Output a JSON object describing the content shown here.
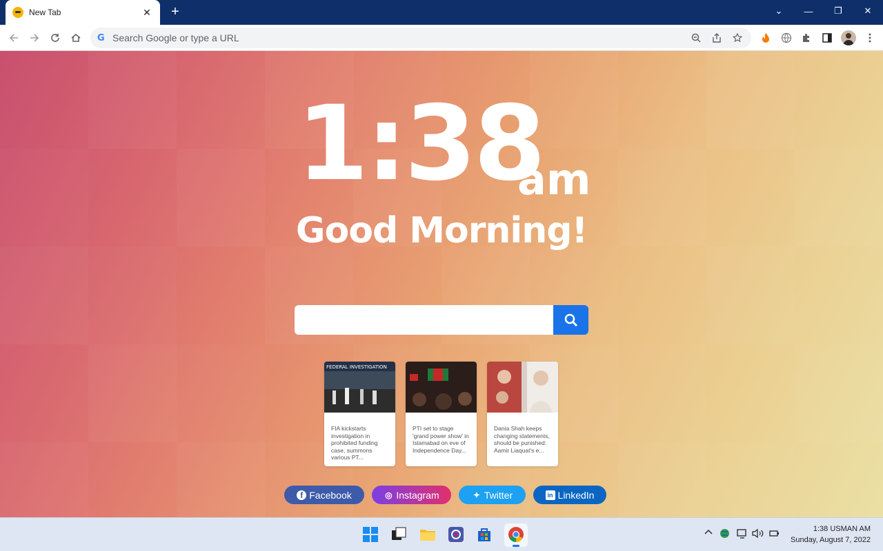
{
  "browser": {
    "tab_title": "New Tab",
    "tab_close": "✕",
    "new_tab": "+",
    "window_controls": [
      "⌄",
      "—",
      "❐",
      "✕"
    ],
    "omnibox_placeholder": "Search Google or type a URL",
    "omnibox_icon": "G"
  },
  "page": {
    "time": "1:38",
    "ampm": "am",
    "greeting": "Good Morning!",
    "search_value": "",
    "news": [
      {
        "text": "FIA kickstarts investigation in prohibited funding case, summons various PT..."
      },
      {
        "text": "PTI set to stage 'grand power show' in Islamabad on eve of Independence Day..."
      },
      {
        "text": "Dania Shah keeps changing statements, should be punished: Aamir Liaquat's e..."
      }
    ],
    "social": [
      {
        "label": "Facebook",
        "icon": "f",
        "color": "#3b5998"
      },
      {
        "label": "Instagram",
        "icon": "◎",
        "color": "#c13584"
      },
      {
        "label": "Twitter",
        "icon": "✦",
        "color": "#1da1f2"
      },
      {
        "label": "LinkedIn",
        "icon": "in",
        "color": "#0077b5"
      }
    ]
  },
  "taskbar": {
    "time": "1:38 USMAN AM",
    "date": "Sunday, August 7, 2022"
  }
}
